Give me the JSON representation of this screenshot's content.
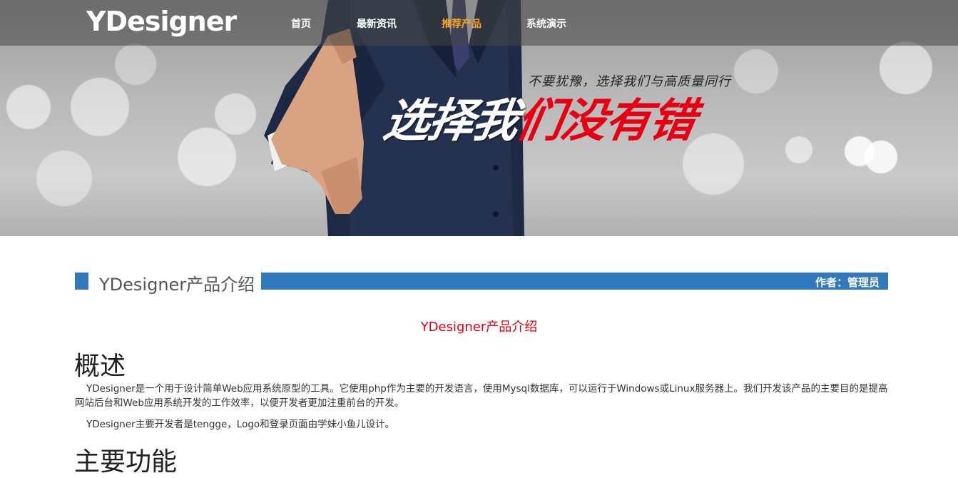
{
  "header": {
    "logo": "YDesigner",
    "nav": [
      {
        "label": "首页",
        "active": false
      },
      {
        "label": "最新资讯",
        "active": false
      },
      {
        "label": "推荐产品",
        "active": true
      },
      {
        "label": "系统演示",
        "active": false
      }
    ]
  },
  "banner": {
    "slogan_small": "不要犹豫，选择我们与高质量同行",
    "slogan_white": "选择我",
    "slogan_red": "们没有错"
  },
  "article": {
    "title": "YDesigner产品介绍",
    "author": "作者：管理员",
    "subtitle": "YDesigner产品介绍",
    "section_overview": "概述",
    "paragraph1": "YDesigner是一个用于设计简单Web应用系统原型的工具。它使用php作为主要的开发语言，使用Mysql数据库，可以运行于Windows或Linux服务器上。我们开发该产品的主要目的是提高网站后台和Web应用系统开发的工作效率，以便开发者更加注重前台的开发。",
    "paragraph2": "YDesigner主要开发者是tengge，Logo和登录页面由学妹小鱼儿设计。",
    "section_features": "主要功能"
  },
  "colors": {
    "accent_blue": "#3178bc",
    "active_nav": "#f7a51e",
    "highlight_red": "#e60012"
  }
}
